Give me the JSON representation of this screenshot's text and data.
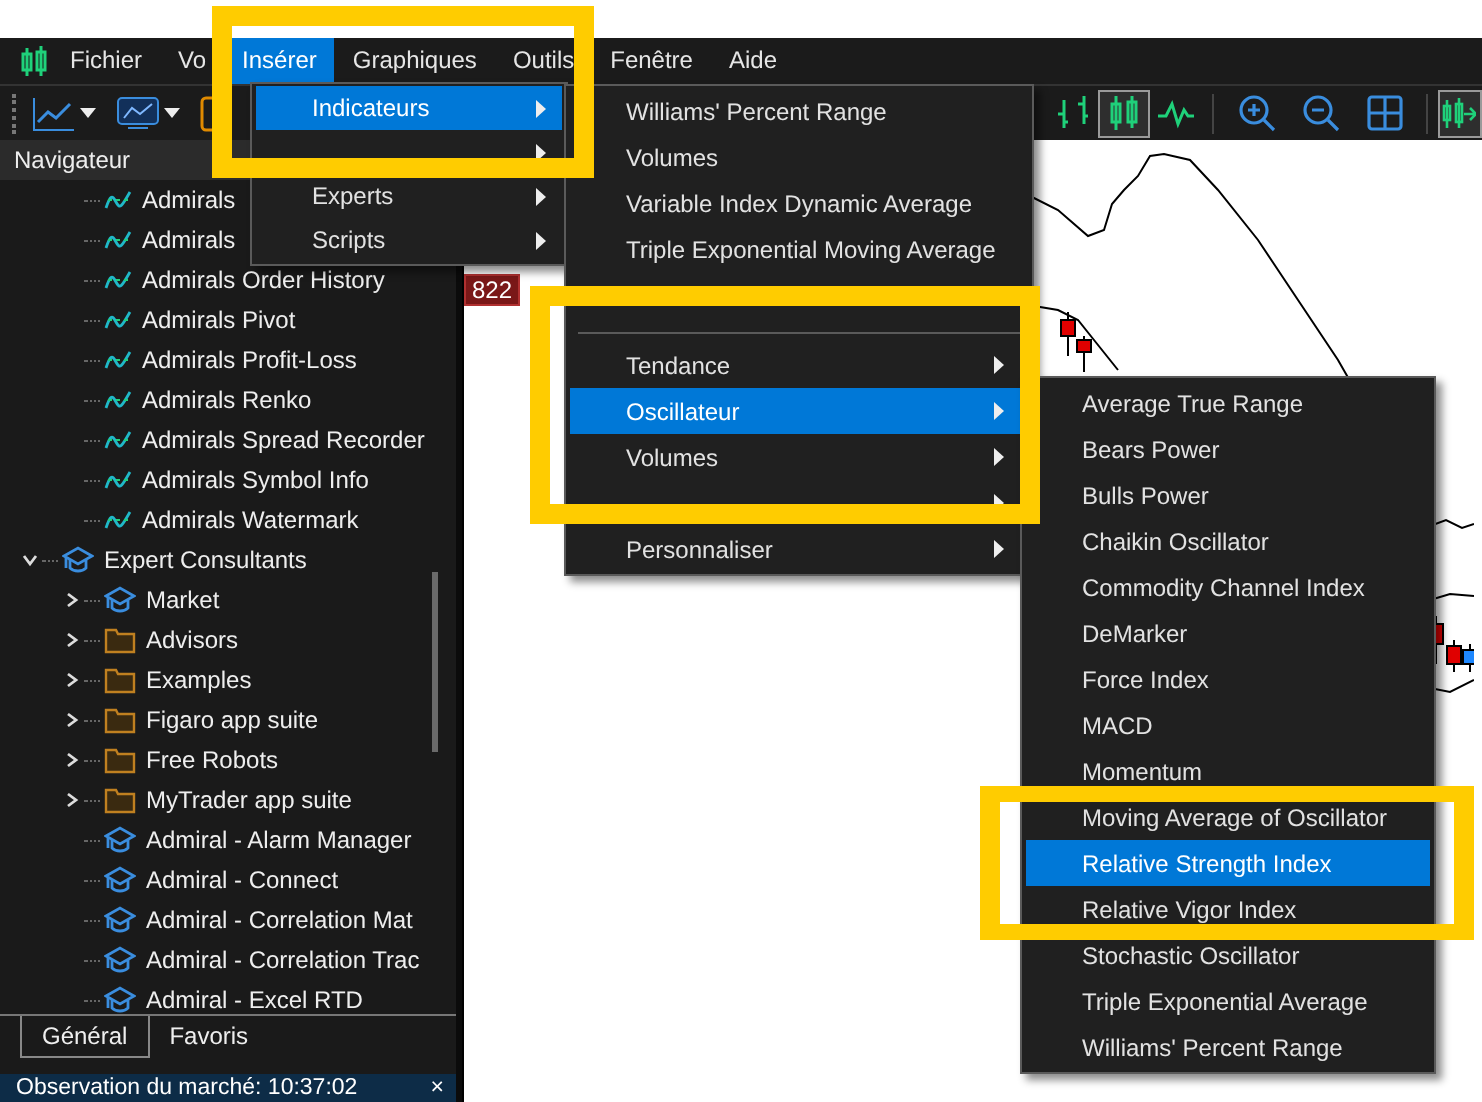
{
  "menubar": {
    "items": [
      {
        "label": "Fichier",
        "selected": false
      },
      {
        "label": "Vo",
        "selected": false
      },
      {
        "label": "Insérer",
        "selected": true
      },
      {
        "label": "Graphiques",
        "selected": false
      },
      {
        "label": "Outils",
        "selected": false
      },
      {
        "label": "Fenêtre",
        "selected": false
      },
      {
        "label": "Aide",
        "selected": false
      }
    ]
  },
  "toolbar": {
    "chart_types": [
      {
        "selected": false
      },
      {
        "selected": true
      },
      {
        "selected": false
      }
    ],
    "chart_shift": {
      "on": true
    }
  },
  "insert_menu": {
    "items": [
      {
        "label": "Indicateurs",
        "kind": "submenu",
        "selected": true
      },
      {
        "kind": "submenu",
        "selected": false
      },
      {
        "label": "Experts",
        "kind": "submenu",
        "selected": false
      },
      {
        "label": "Scripts",
        "kind": "submenu",
        "selected": false
      }
    ]
  },
  "indicators_menu": {
    "items": [
      {
        "label": "Williams' Percent Range",
        "kind": "item",
        "selected": false
      },
      {
        "label": "Volumes",
        "kind": "item",
        "selected": false
      },
      {
        "label": "Variable Index Dynamic Average",
        "kind": "item",
        "selected": false
      },
      {
        "label": "Triple Exponential Moving Average",
        "kind": "item",
        "selected": false
      },
      {
        "kind": "separator"
      },
      {
        "label": "Tendance",
        "kind": "submenu",
        "selected": false
      },
      {
        "label": "Oscillateur",
        "kind": "submenu",
        "selected": true
      },
      {
        "label": "Volumes",
        "kind": "submenu",
        "selected": false
      },
      {
        "kind": "submenu",
        "selected": false
      },
      {
        "label": "Personnaliser",
        "kind": "submenu",
        "selected": false
      }
    ]
  },
  "oscillators_menu": {
    "items": [
      {
        "label": "Average True Range",
        "kind": "item",
        "selected": false
      },
      {
        "label": "Bears Power",
        "kind": "item",
        "selected": false
      },
      {
        "label": "Bulls Power",
        "kind": "item",
        "selected": false
      },
      {
        "label": "Chaikin Oscillator",
        "kind": "item",
        "selected": false
      },
      {
        "label": "Commodity Channel Index",
        "kind": "item",
        "selected": false
      },
      {
        "label": "DeMarker",
        "kind": "item",
        "selected": false
      },
      {
        "label": "Force Index",
        "kind": "item",
        "selected": false
      },
      {
        "label": "MACD",
        "kind": "item",
        "selected": false
      },
      {
        "label": "Momentum",
        "kind": "item",
        "selected": false
      },
      {
        "label": "Moving Average of Oscillator",
        "kind": "item",
        "selected": false
      },
      {
        "label": "Relative Strength Index",
        "kind": "item",
        "selected": true
      },
      {
        "label": "Relative Vigor Index",
        "kind": "item",
        "selected": false
      },
      {
        "label": "Stochastic Oscillator",
        "kind": "item",
        "selected": false
      },
      {
        "label": "Triple Exponential Average",
        "kind": "item",
        "selected": false
      },
      {
        "label": "Williams' Percent Range",
        "kind": "item",
        "selected": false
      }
    ]
  },
  "navigator": {
    "title": "Navigateur",
    "items": [
      {
        "label": "Admirals",
        "kind": "indicator"
      },
      {
        "label": "Admirals",
        "kind": "indicator"
      },
      {
        "label": "Admirals Order History",
        "kind": "indicator"
      },
      {
        "label": "Admirals Pivot",
        "kind": "indicator"
      },
      {
        "label": "Admirals Profit-Loss",
        "kind": "indicator"
      },
      {
        "label": "Admirals Renko",
        "kind": "indicator"
      },
      {
        "label": "Admirals Spread Recorder",
        "kind": "indicator"
      },
      {
        "label": "Admirals Symbol Info",
        "kind": "indicator"
      },
      {
        "label": "Admirals Watermark",
        "kind": "indicator"
      },
      {
        "label": "Expert Consultants",
        "kind": "expert",
        "expanded": true,
        "children": [
          {
            "label": "Market",
            "kind": "expert",
            "expanded": false
          },
          {
            "label": "Advisors",
            "kind": "folder",
            "expanded": false
          },
          {
            "label": "Examples",
            "kind": "folder",
            "expanded": false
          },
          {
            "label": "Figaro app suite",
            "kind": "folder",
            "expanded": false
          },
          {
            "label": "Free Robots",
            "kind": "folder",
            "expanded": false
          },
          {
            "label": "MyTrader app suite",
            "kind": "folder",
            "expanded": false
          },
          {
            "label": "Admiral - Alarm Manager",
            "kind": "expert"
          },
          {
            "label": "Admiral - Connect",
            "kind": "expert"
          },
          {
            "label": "Admiral - Correlation Mat",
            "kind": "expert"
          },
          {
            "label": "Admiral - Correlation Trac",
            "kind": "expert"
          },
          {
            "label": "Admiral - Excel RTD",
            "kind": "expert"
          }
        ]
      }
    ],
    "tabs": [
      {
        "label": "Général",
        "selected": true
      },
      {
        "label": "Favoris",
        "selected": false
      }
    ]
  },
  "chart": {
    "price_tag": "822"
  },
  "status_bar": {
    "text": "Observation du marché: 10:37:02",
    "close": "×"
  }
}
